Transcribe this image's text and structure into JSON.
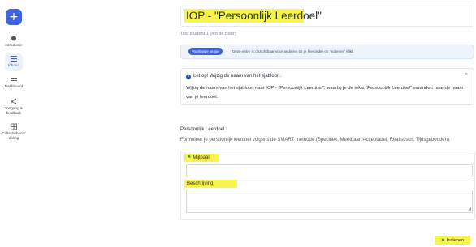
{
  "sidebar": {
    "add_button": "+",
    "items": [
      {
        "label": "Introductie",
        "icon": "circle-dot-icon"
      },
      {
        "label": "Inhoud",
        "icon": "list-icon",
        "active": true
      },
      {
        "label": "Dashboard",
        "icon": "bars-icon"
      },
      {
        "label": "Toegang & feedback",
        "icon": "share-icon"
      },
      {
        "label": "Collectiebeoordeling",
        "icon": "table-icon"
      }
    ]
  },
  "main": {
    "title": "IOP - \"Persoonlijk Leerdoel\"",
    "subtitle": "Test student 1 (Ivo de Boer)",
    "status": {
      "badge": "Voorlopige versie",
      "text": "Deze entry is onzichtbaar voor anderen tot je hieronder op 'Indienen' klikt."
    },
    "notice": {
      "heading": "Let op! Wijzig de naam van het sjabloon.",
      "body_1": "Wijzig de naam van het sjabloon naar IOP - ",
      "body_em": "\"Persoonlijk Leerdoel\"",
      "body_2": ", waarbij je de tekst ",
      "body_em2": "\"Persoonlijk Leerdoel\"",
      "body_3": " verandert naar de naam van je leerdoel."
    },
    "field": {
      "label": "Persoonlijk Leerdoel",
      "required_mark": "*",
      "help": "Formuleer je persoonlijk leerdoel volgens de SMART methode (Specifiek, Meetbaar, Acceptabel, Realistisch, Tijdsgebonden)."
    },
    "milestone_label": "Mijlpaal",
    "milestone_value": "",
    "description_label": "Beschrijving",
    "description_value": "",
    "submit_label": "Indienen"
  },
  "colors": {
    "accent": "#3d63dd",
    "highlight": "#f7f54b",
    "info_bg": "#eef3fc"
  }
}
